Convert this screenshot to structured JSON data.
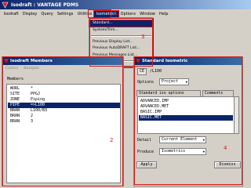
{
  "window": {
    "title": "Isodraft : VANTAGE PDMS"
  },
  "menu": {
    "items": [
      {
        "label": "Isodraft"
      },
      {
        "label": "Display"
      },
      {
        "label": "Query"
      },
      {
        "label": "Settings"
      },
      {
        "label": "Utilities"
      },
      {
        "label": "Isometrics",
        "active": true
      },
      {
        "label": "Options"
      },
      {
        "label": "Window"
      },
      {
        "label": "Help"
      }
    ]
  },
  "dropdown": {
    "items": [
      {
        "label": "Standard...",
        "highlight": true
      },
      {
        "label": "System/Trim..."
      },
      {
        "label": "Previous Display List..."
      },
      {
        "label": "Previous AutoDRAFT List..."
      },
      {
        "label": "Previous Messages List..."
      }
    ]
  },
  "members": {
    "title": "Isodraft Members",
    "menu": [
      "Control",
      "Navigate"
    ],
    "label": "Members",
    "rows": [
      {
        "key": "WORL",
        "value": "*"
      },
      {
        "key": "SITE",
        "value": "PPGJ"
      },
      {
        "key": "ZONE",
        "value": "Piping"
      },
      {
        "key": "PIPE",
        "value": "=>L100",
        "selected": true
      },
      {
        "key": "BRAN",
        "value": "L100/B3"
      },
      {
        "key": "BRAN",
        "value": "2"
      },
      {
        "key": "BRAN",
        "value": "3"
      }
    ]
  },
  "iso": {
    "title": "Standard Isometric",
    "ce_button": "CE",
    "ce_value": "/L100",
    "options_label": "Options",
    "options_value": "Project",
    "tabs": [
      "Standard iso options",
      "Comments"
    ],
    "list": [
      {
        "label": "ADVANCED.IMP"
      },
      {
        "label": "ADVANCED.MET"
      },
      {
        "label": "BASIC.IMP"
      },
      {
        "label": "BASIC.MET",
        "selected": true
      }
    ],
    "detail_label": "Detail",
    "detail_value": "Current Element",
    "produce_label": "Produce",
    "produce_value": "Isometrics",
    "apply_button": "Apply",
    "dismiss_button": "Dismiss"
  },
  "annotations": [
    "1",
    "2",
    "3",
    "4"
  ],
  "colors": {
    "title_bar": "#0a246a",
    "selection": "#0a246a",
    "annotation": "#d81818",
    "window_bg": "#d4d0c8"
  }
}
